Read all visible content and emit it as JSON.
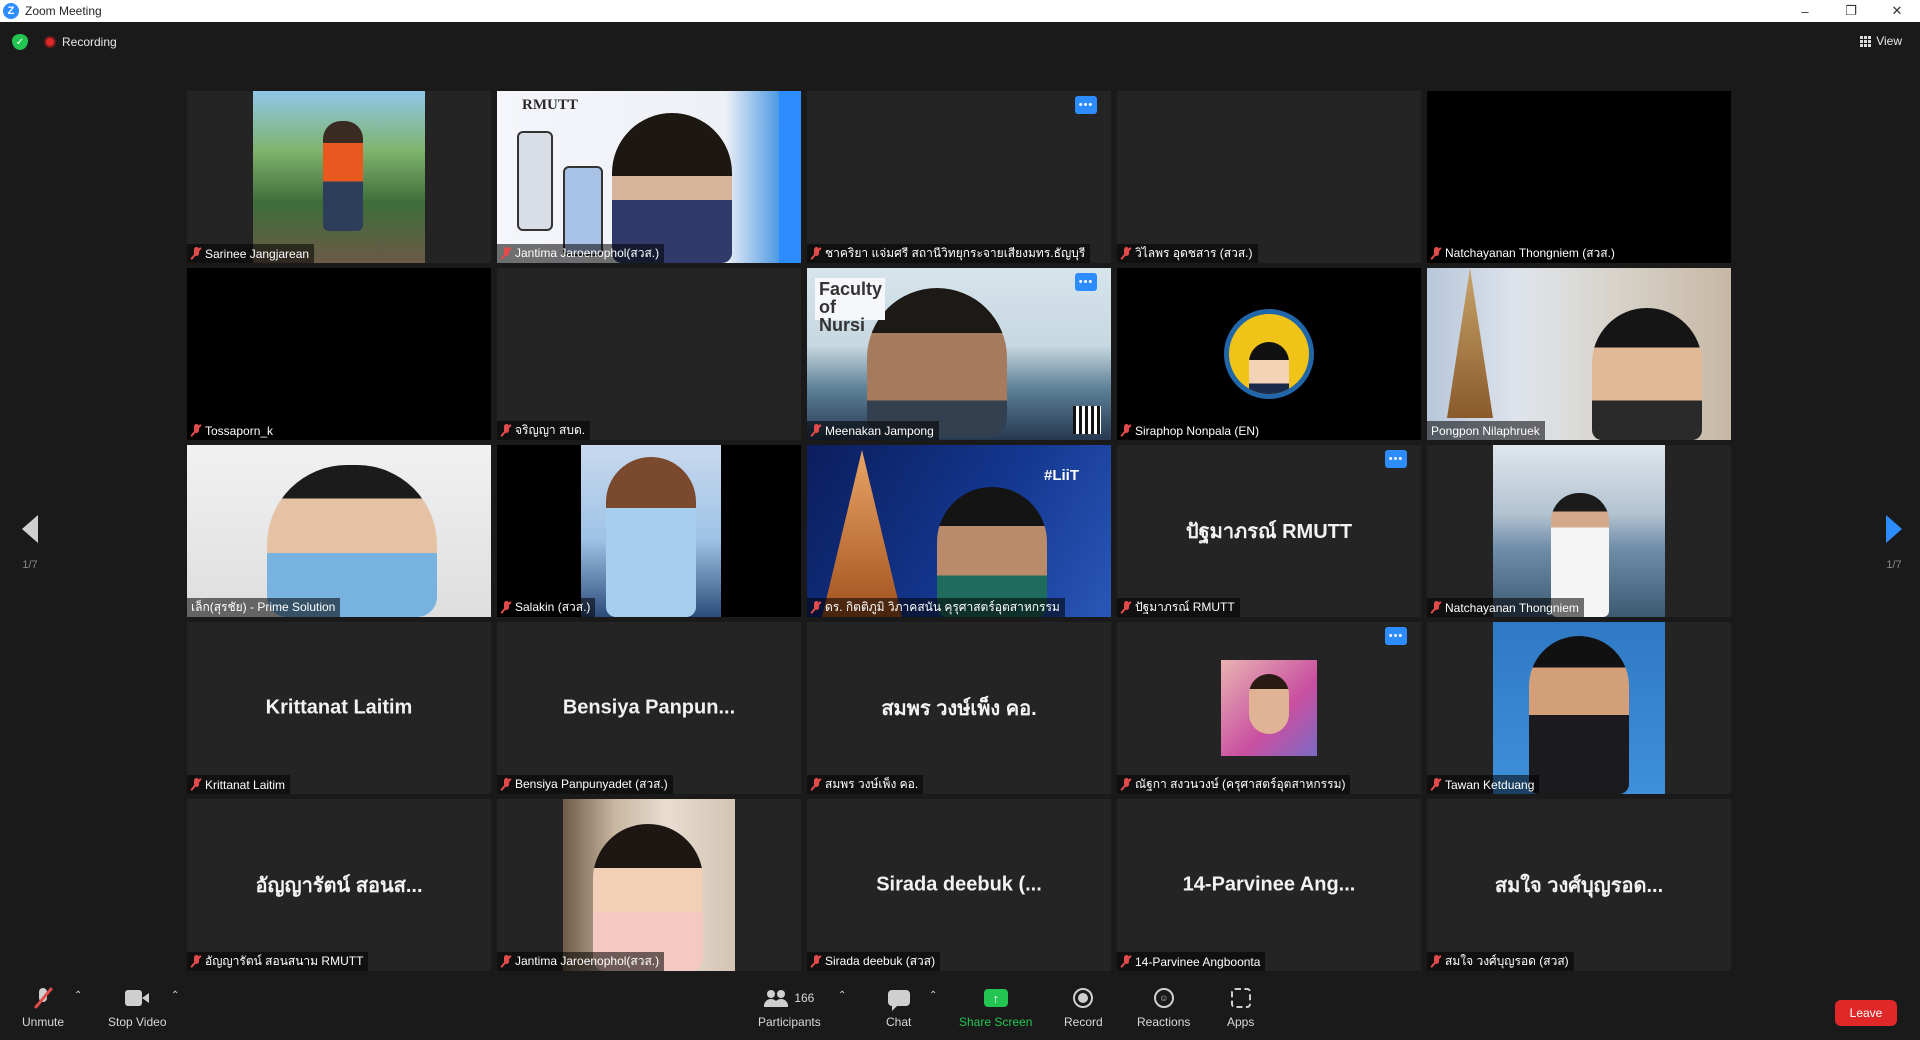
{
  "window": {
    "title": "Zoom Meeting",
    "logo_letter": "Z",
    "controls": {
      "minimize": "–",
      "restore": "❐",
      "close": "✕"
    }
  },
  "topbar": {
    "recording_label": "Recording",
    "view_label": "View"
  },
  "gallery": {
    "page_indicator": "1/7",
    "tiles": [
      {
        "name": "Sarinee Jangjarean",
        "muted": true
      },
      {
        "name": "Jantima Jaroenophol(สวส.)",
        "muted": true,
        "logo_text": "RMUTT"
      },
      {
        "name": "ชาคริยา แจ่มศรี สถานีวิทยุกระจายเสียงมทร.ธัญบุรี",
        "muted": true
      },
      {
        "name": "วิไลพร อุดชสาร (สวส.)",
        "muted": true
      },
      {
        "name": "Natchayanan Thongniem (สวส.)",
        "muted": true
      },
      {
        "name": "Tossaporn_k",
        "muted": true
      },
      {
        "name": "จริญญา สบด.",
        "muted": true
      },
      {
        "name": "Meenakan Jampong",
        "muted": true,
        "banner_text": "Faculty of Nursi"
      },
      {
        "name": "Siraphop Nonpala (EN)",
        "muted": true
      },
      {
        "name": "Pongpon Nilaphruek",
        "muted": false,
        "active_speaker": true
      },
      {
        "name": "เล็ก(สุรชัย) - Prime Solution",
        "muted": false
      },
      {
        "name": "Salakin  (สวส.)",
        "muted": true
      },
      {
        "name": "ดร. กิตติภูมิ วิภาคสนัน คุรุศาสตร์อุตสาหกรรม",
        "muted": true,
        "overlay_text": "#LiiT"
      },
      {
        "name": "ปัฐมาภรณ์ RMUTT",
        "muted": true,
        "display_name": "ปัฐมาภรณ์ RMUTT"
      },
      {
        "name": "Natchayanan Thongniem",
        "muted": true
      },
      {
        "name": "Krittanat Laitim",
        "muted": true,
        "display_name": "Krittanat Laitim"
      },
      {
        "name": "Bensiya Panpunyadet (สวส.)",
        "muted": true,
        "display_name": "Bensiya  Panpun..."
      },
      {
        "name": "สมพร วงษ์เพ็ง คอ.",
        "muted": true,
        "display_name": "สมพร วงษ์เพ็ง คอ."
      },
      {
        "name": "ณัฐกา สงวนวงษ์ (ครุศาสตร์อุตสาหกรรม)",
        "muted": true
      },
      {
        "name": "Tawan Ketduang",
        "muted": true
      },
      {
        "name": "อัญญารัตน์ สอนสนาม RMUTT",
        "muted": true,
        "display_name": "อัญญารัตน์ สอนส..."
      },
      {
        "name": "Jantima Jaroenophol(สวส.)",
        "muted": true
      },
      {
        "name": "Sirada deebuk (สวส)",
        "muted": true,
        "display_name": "Sirada deebuk (..."
      },
      {
        "name": "14-Parvinee Angboonta",
        "muted": true,
        "display_name": "14-Parvinee Ang..."
      },
      {
        "name": "สมใจ วงศ์บุญรอด (สวส)",
        "muted": true,
        "display_name": "สมใจ วงศ์บุญรอด..."
      }
    ]
  },
  "toolbar": {
    "unmute": "Unmute",
    "stop_video": "Stop Video",
    "participants": "Participants",
    "participant_count": "166",
    "chat": "Chat",
    "share_screen": "Share Screen",
    "record": "Record",
    "reactions": "Reactions",
    "apps": "Apps",
    "leave": "Leave"
  },
  "colors": {
    "accent": "#2d8cff",
    "share_green": "#23c552",
    "leave_red": "#e02828",
    "active_speaker": "#f2ec8c"
  }
}
